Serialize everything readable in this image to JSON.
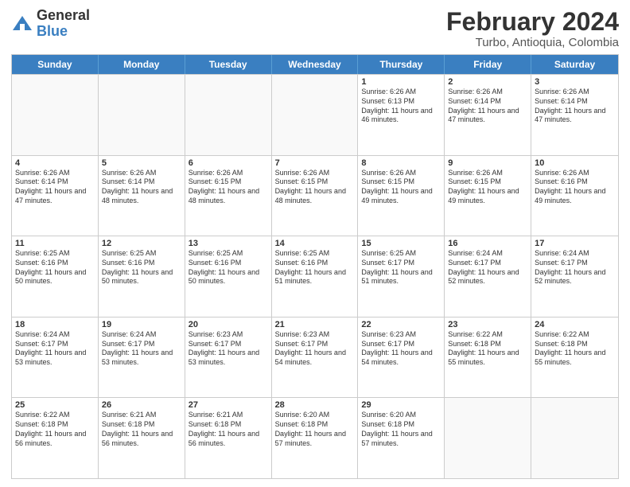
{
  "logo": {
    "general": "General",
    "blue": "Blue"
  },
  "title": "February 2024",
  "subtitle": "Turbo, Antioquia, Colombia",
  "headers": [
    "Sunday",
    "Monday",
    "Tuesday",
    "Wednesday",
    "Thursday",
    "Friday",
    "Saturday"
  ],
  "rows": [
    [
      {
        "date": "",
        "info": "",
        "empty": true
      },
      {
        "date": "",
        "info": "",
        "empty": true
      },
      {
        "date": "",
        "info": "",
        "empty": true
      },
      {
        "date": "",
        "info": "",
        "empty": true
      },
      {
        "date": "1",
        "info": "Sunrise: 6:26 AM\nSunset: 6:13 PM\nDaylight: 11 hours and 46 minutes.",
        "empty": false
      },
      {
        "date": "2",
        "info": "Sunrise: 6:26 AM\nSunset: 6:14 PM\nDaylight: 11 hours and 47 minutes.",
        "empty": false
      },
      {
        "date": "3",
        "info": "Sunrise: 6:26 AM\nSunset: 6:14 PM\nDaylight: 11 hours and 47 minutes.",
        "empty": false
      }
    ],
    [
      {
        "date": "4",
        "info": "Sunrise: 6:26 AM\nSunset: 6:14 PM\nDaylight: 11 hours and 47 minutes.",
        "empty": false
      },
      {
        "date": "5",
        "info": "Sunrise: 6:26 AM\nSunset: 6:14 PM\nDaylight: 11 hours and 48 minutes.",
        "empty": false
      },
      {
        "date": "6",
        "info": "Sunrise: 6:26 AM\nSunset: 6:15 PM\nDaylight: 11 hours and 48 minutes.",
        "empty": false
      },
      {
        "date": "7",
        "info": "Sunrise: 6:26 AM\nSunset: 6:15 PM\nDaylight: 11 hours and 48 minutes.",
        "empty": false
      },
      {
        "date": "8",
        "info": "Sunrise: 6:26 AM\nSunset: 6:15 PM\nDaylight: 11 hours and 49 minutes.",
        "empty": false
      },
      {
        "date": "9",
        "info": "Sunrise: 6:26 AM\nSunset: 6:15 PM\nDaylight: 11 hours and 49 minutes.",
        "empty": false
      },
      {
        "date": "10",
        "info": "Sunrise: 6:26 AM\nSunset: 6:16 PM\nDaylight: 11 hours and 49 minutes.",
        "empty": false
      }
    ],
    [
      {
        "date": "11",
        "info": "Sunrise: 6:25 AM\nSunset: 6:16 PM\nDaylight: 11 hours and 50 minutes.",
        "empty": false
      },
      {
        "date": "12",
        "info": "Sunrise: 6:25 AM\nSunset: 6:16 PM\nDaylight: 11 hours and 50 minutes.",
        "empty": false
      },
      {
        "date": "13",
        "info": "Sunrise: 6:25 AM\nSunset: 6:16 PM\nDaylight: 11 hours and 50 minutes.",
        "empty": false
      },
      {
        "date": "14",
        "info": "Sunrise: 6:25 AM\nSunset: 6:16 PM\nDaylight: 11 hours and 51 minutes.",
        "empty": false
      },
      {
        "date": "15",
        "info": "Sunrise: 6:25 AM\nSunset: 6:17 PM\nDaylight: 11 hours and 51 minutes.",
        "empty": false
      },
      {
        "date": "16",
        "info": "Sunrise: 6:24 AM\nSunset: 6:17 PM\nDaylight: 11 hours and 52 minutes.",
        "empty": false
      },
      {
        "date": "17",
        "info": "Sunrise: 6:24 AM\nSunset: 6:17 PM\nDaylight: 11 hours and 52 minutes.",
        "empty": false
      }
    ],
    [
      {
        "date": "18",
        "info": "Sunrise: 6:24 AM\nSunset: 6:17 PM\nDaylight: 11 hours and 53 minutes.",
        "empty": false
      },
      {
        "date": "19",
        "info": "Sunrise: 6:24 AM\nSunset: 6:17 PM\nDaylight: 11 hours and 53 minutes.",
        "empty": false
      },
      {
        "date": "20",
        "info": "Sunrise: 6:23 AM\nSunset: 6:17 PM\nDaylight: 11 hours and 53 minutes.",
        "empty": false
      },
      {
        "date": "21",
        "info": "Sunrise: 6:23 AM\nSunset: 6:17 PM\nDaylight: 11 hours and 54 minutes.",
        "empty": false
      },
      {
        "date": "22",
        "info": "Sunrise: 6:23 AM\nSunset: 6:17 PM\nDaylight: 11 hours and 54 minutes.",
        "empty": false
      },
      {
        "date": "23",
        "info": "Sunrise: 6:22 AM\nSunset: 6:18 PM\nDaylight: 11 hours and 55 minutes.",
        "empty": false
      },
      {
        "date": "24",
        "info": "Sunrise: 6:22 AM\nSunset: 6:18 PM\nDaylight: 11 hours and 55 minutes.",
        "empty": false
      }
    ],
    [
      {
        "date": "25",
        "info": "Sunrise: 6:22 AM\nSunset: 6:18 PM\nDaylight: 11 hours and 56 minutes.",
        "empty": false
      },
      {
        "date": "26",
        "info": "Sunrise: 6:21 AM\nSunset: 6:18 PM\nDaylight: 11 hours and 56 minutes.",
        "empty": false
      },
      {
        "date": "27",
        "info": "Sunrise: 6:21 AM\nSunset: 6:18 PM\nDaylight: 11 hours and 56 minutes.",
        "empty": false
      },
      {
        "date": "28",
        "info": "Sunrise: 6:20 AM\nSunset: 6:18 PM\nDaylight: 11 hours and 57 minutes.",
        "empty": false
      },
      {
        "date": "29",
        "info": "Sunrise: 6:20 AM\nSunset: 6:18 PM\nDaylight: 11 hours and 57 minutes.",
        "empty": false
      },
      {
        "date": "",
        "info": "",
        "empty": true
      },
      {
        "date": "",
        "info": "",
        "empty": true
      }
    ]
  ]
}
